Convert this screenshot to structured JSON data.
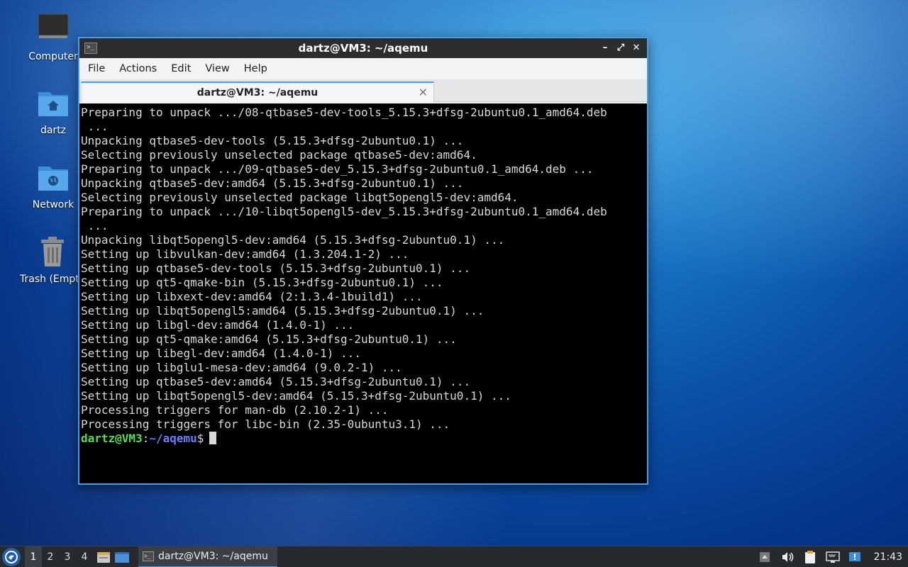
{
  "desktop": {
    "icons": [
      {
        "label": "Computer"
      },
      {
        "label": "dartz"
      },
      {
        "label": "Network"
      },
      {
        "label": "Trash (Empt"
      }
    ]
  },
  "window": {
    "title": "dartz@VM3: ~/aqemu",
    "menu": [
      "File",
      "Actions",
      "Edit",
      "View",
      "Help"
    ],
    "tab_title": "dartz@VM3: ~/aqemu",
    "tab_close": "×",
    "controls": {
      "minimize": "–",
      "maximize": "⤢",
      "close": "✕"
    }
  },
  "terminal": {
    "lines": [
      "Preparing to unpack .../08-qtbase5-dev-tools_5.15.3+dfsg-2ubuntu0.1_amd64.deb",
      " ...",
      "Unpacking qtbase5-dev-tools (5.15.3+dfsg-2ubuntu0.1) ...",
      "Selecting previously unselected package qtbase5-dev:amd64.",
      "Preparing to unpack .../09-qtbase5-dev_5.15.3+dfsg-2ubuntu0.1_amd64.deb ...",
      "Unpacking qtbase5-dev:amd64 (5.15.3+dfsg-2ubuntu0.1) ...",
      "Selecting previously unselected package libqt5opengl5-dev:amd64.",
      "Preparing to unpack .../10-libqt5opengl5-dev_5.15.3+dfsg-2ubuntu0.1_amd64.deb",
      " ...",
      "Unpacking libqt5opengl5-dev:amd64 (5.15.3+dfsg-2ubuntu0.1) ...",
      "Setting up libvulkan-dev:amd64 (1.3.204.1-2) ...",
      "Setting up qtbase5-dev-tools (5.15.3+dfsg-2ubuntu0.1) ...",
      "Setting up qt5-qmake-bin (5.15.3+dfsg-2ubuntu0.1) ...",
      "Setting up libxext-dev:amd64 (2:1.3.4-1build1) ...",
      "Setting up libqt5opengl5:amd64 (5.15.3+dfsg-2ubuntu0.1) ...",
      "Setting up libgl-dev:amd64 (1.4.0-1) ...",
      "Setting up qt5-qmake:amd64 (5.15.3+dfsg-2ubuntu0.1) ...",
      "Setting up libegl-dev:amd64 (1.4.0-1) ...",
      "Setting up libglu1-mesa-dev:amd64 (9.0.2-1) ...",
      "Setting up qtbase5-dev:amd64 (5.15.3+dfsg-2ubuntu0.1) ...",
      "Setting up libqt5opengl5-dev:amd64 (5.15.3+dfsg-2ubuntu0.1) ...",
      "Processing triggers for man-db (2.10.2-1) ...",
      "Processing triggers for libc-bin (2.35-0ubuntu3.1) ..."
    ],
    "prompt_user": "dartz@VM3",
    "prompt_sep": ":",
    "prompt_path": "~/aqemu",
    "prompt_symbol": "$"
  },
  "taskbar": {
    "workspaces": [
      "1",
      "2",
      "3",
      "4"
    ],
    "task_label": "dartz@VM3: ~/aqemu",
    "clock": "21:43"
  },
  "colors": {
    "accent": "#4a9be8",
    "prompt_user": "#4fe04f",
    "prompt_path": "#6a7cff"
  }
}
